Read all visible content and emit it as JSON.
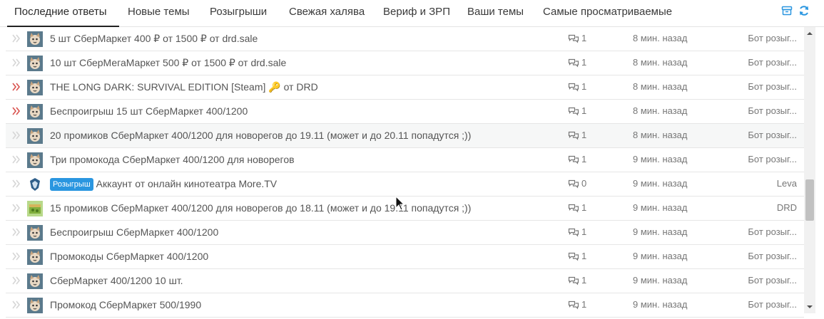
{
  "tabs": [
    {
      "label": "Последние ответы",
      "active": true
    },
    {
      "label": "Новые темы"
    },
    {
      "label": "Розыгрыши"
    },
    {
      "label": "Свежая халява"
    },
    {
      "label": "Вериф и ЗРП"
    },
    {
      "label": "Ваши темы"
    },
    {
      "label": "Самые просматриваемые"
    }
  ],
  "colors": {
    "accent": "#2a96e0",
    "hot": "#d9534f"
  },
  "threads": [
    {
      "title": "5 шт СберМаркет 400 ₽ от 1500 ₽ от drd.sale",
      "replies": "1",
      "time": "8 мин. назад",
      "author": "Бот розыг...",
      "hot": false,
      "avatar": "cat-avatar"
    },
    {
      "title": "10 шт СберМегаМаркет 500 ₽ от 1500 ₽ от drd.sale",
      "replies": "1",
      "time": "8 мин. назад",
      "author": "Бот розыг...",
      "hot": false,
      "avatar": "cat-avatar"
    },
    {
      "title": "THE LONG DARK: SURVIVAL EDITION [Steam] 🔑 от DRD",
      "replies": "1",
      "time": "8 мин. назад",
      "author": "Бот розыг...",
      "hot": true,
      "avatar": "cat-avatar"
    },
    {
      "title": "Беспроигрыш 15 шт СберМаркет 400/1200",
      "replies": "1",
      "time": "8 мин. назад",
      "author": "Бот розыг...",
      "hot": true,
      "avatar": "cat-avatar"
    },
    {
      "title": "20 промиков СберМаркет 400/1200 для новорегов до 19.11 (может и до 20.11 попадутся ;))",
      "replies": "1",
      "time": "8 мин. назад",
      "author": "Бот розыг...",
      "hot": false,
      "avatar": "cat-avatar"
    },
    {
      "title": "Три промокода СберМаркет 400/1200 для новорегов",
      "replies": "1",
      "time": "9 мин. назад",
      "author": "Бот розыг...",
      "hot": false,
      "avatar": "cat-avatar"
    },
    {
      "badge": "Розыгрыш",
      "title": "Аккаунт от онлайн кинотеатра More.TV",
      "replies": "0",
      "time": "9 мин. назад",
      "author": "Leva",
      "hot": false,
      "avatar": "wolf-avatar"
    },
    {
      "title": "15 промиков СберМаркет 400/1200 для новорегов до 18.11 (может и до 19.11 попадутся ;))",
      "replies": "1",
      "time": "9 мин. назад",
      "author": "DRD",
      "hot": false,
      "avatar": "box-avatar"
    },
    {
      "title": "Беспроигрыш СберМаркет 400/1200",
      "replies": "1",
      "time": "9 мин. назад",
      "author": "Бот розыг...",
      "hot": false,
      "avatar": "cat-avatar"
    },
    {
      "title": "Промокоды СберМаркет 400/1200",
      "replies": "1",
      "time": "9 мин. назад",
      "author": "Бот розыг...",
      "hot": false,
      "avatar": "cat-avatar"
    },
    {
      "title": "СберМаркет 400/1200 10 шт.",
      "replies": "1",
      "time": "9 мин. назад",
      "author": "Бот розыг...",
      "hot": false,
      "avatar": "cat-avatar"
    },
    {
      "title": "Промокод СберМаркет 500/1990",
      "replies": "1",
      "time": "9 мин. назад",
      "author": "Бот розыг...",
      "hot": false,
      "avatar": "cat-avatar"
    }
  ]
}
